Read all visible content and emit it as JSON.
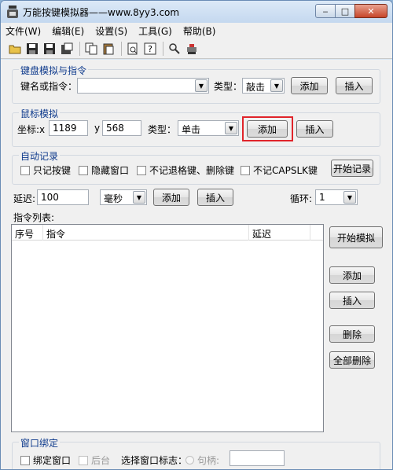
{
  "window": {
    "title": "万能按键模拟器——www.8yy3.com",
    "minimize": "‒",
    "maximize": "□",
    "close": "✕"
  },
  "menu": [
    "文件(W)",
    "编辑(E)",
    "设置(S)",
    "工具(G)",
    "帮助(B)"
  ],
  "toolbar_icons": [
    "open-folder-icon",
    "save-icon",
    "save-as-icon",
    "export-icon",
    "copy-icon",
    "paste-icon",
    "preview-icon",
    "help-icon",
    "find-icon",
    "tool-icon"
  ],
  "keyboard": {
    "group_label": "键盘模拟与指令",
    "key_label": "键名或指令：",
    "key_value": "",
    "type_label": "类型：",
    "type_value": "敲击",
    "add": "添加",
    "insert": "插入"
  },
  "mouse": {
    "group_label": "鼠标模拟",
    "coord_label": "坐标:x",
    "x_value": "1189",
    "y_label": "y",
    "y_value": "568",
    "type_label": "类型：",
    "type_value": "单击",
    "add": "添加",
    "insert": "插入"
  },
  "autorecord": {
    "group_label": "自动记录",
    "options": [
      "只记按键",
      "隐藏窗口",
      "不记退格键、删除键",
      "不记CAPSLK键"
    ],
    "start": "开始记录"
  },
  "delay": {
    "label": "延迟:",
    "value": "100",
    "unit": "毫秒",
    "add": "添加",
    "insert": "插入",
    "loop_label": "循环:",
    "loop_value": "1"
  },
  "command_list": {
    "label": "指令列表:",
    "columns": [
      "序号",
      "指令",
      "延迟"
    ]
  },
  "side_buttons": {
    "start_sim": "开始模拟",
    "add": "添加",
    "insert": "插入",
    "delete": "删除",
    "delete_all": "全部删除"
  },
  "window_bind": {
    "group_label": "窗口绑定",
    "bind_label": "绑定窗口",
    "background_label": "后台",
    "select_label": "选择窗口标志：",
    "handle_label": "句柄:"
  }
}
